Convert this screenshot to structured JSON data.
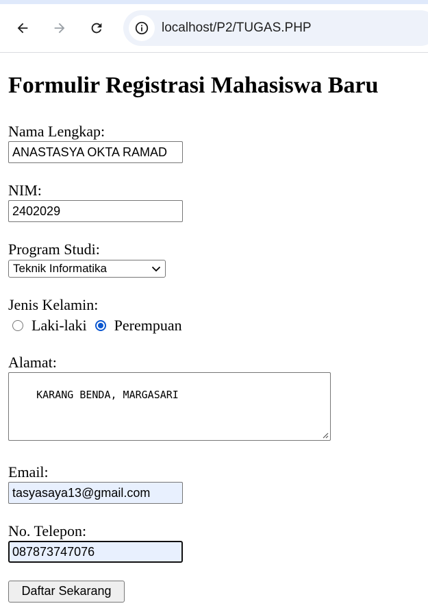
{
  "browser": {
    "url": "localhost/P2/TUGAS.PHP",
    "back_icon": "arrow-left-icon",
    "forward_icon": "arrow-right-icon",
    "reload_icon": "reload-icon",
    "site_info_icon": "info-icon"
  },
  "form": {
    "title": "Formulir Registrasi Mahasiswa Baru",
    "nama": {
      "label": "Nama Lengkap:",
      "value": "ANASTASYA OKTA RAMAD"
    },
    "nim": {
      "label": "NIM:",
      "value": "2402029"
    },
    "prodi": {
      "label": "Program Studi:",
      "selected": "Teknik Informatika"
    },
    "gender": {
      "label": "Jenis Kelamin:",
      "options": [
        {
          "label": "Laki-laki",
          "checked": false
        },
        {
          "label": "Perempuan",
          "checked": true
        }
      ]
    },
    "alamat": {
      "label": "Alamat:",
      "value": "KARANG BENDA, MARGASARI"
    },
    "email": {
      "label": "Email:",
      "value": "tasyasaya13@gmail.com"
    },
    "telepon": {
      "label": "No. Telepon:",
      "value": "087873747076"
    },
    "submit_label": "Daftar Sekarang"
  },
  "colors": {
    "radio_checked": "#0b57d0",
    "autofill_bg": "#e8f0fe",
    "omnibox_bg": "#eef2fa"
  }
}
